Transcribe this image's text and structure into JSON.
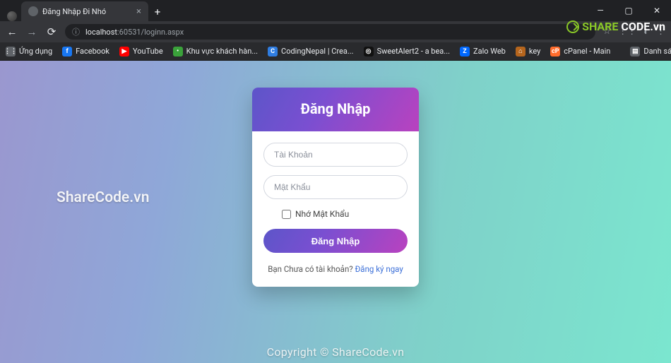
{
  "browser": {
    "tab_title": "Đăng Nhập Đi Nhó",
    "url_host": "localhost",
    "url_rest": ":60531/loginn.aspx",
    "window_controls": {
      "min": "—",
      "max": "▢",
      "close": "✕"
    },
    "bookmarks_label": "Ứng dụng",
    "bookmarks": [
      {
        "label": "Facebook",
        "bg": "#1877f2",
        "ch": "f"
      },
      {
        "label": "YouTube",
        "bg": "#ff0000",
        "ch": "▶"
      },
      {
        "label": "Khu vực khách hàn...",
        "bg": "#3aa23a",
        "ch": "•"
      },
      {
        "label": "CodingNepal | Crea...",
        "bg": "#2f7de1",
        "ch": "C"
      },
      {
        "label": "SweetAlert2 - a bea...",
        "bg": "#111",
        "ch": "◎"
      },
      {
        "label": "Zalo Web",
        "bg": "#0068ff",
        "ch": "Z"
      },
      {
        "label": "key",
        "bg": "#b5651d",
        "ch": "⌂"
      },
      {
        "label": "cPanel - Main",
        "bg": "#ff6c2c",
        "ch": "cP"
      }
    ],
    "reading_list": "Danh sách đọc"
  },
  "login": {
    "title": "Đăng Nhập",
    "username_placeholder": "Tài Khoản",
    "password_placeholder": "Mật Khẩu",
    "remember_label": "Nhớ Mật Khẩu",
    "submit_label": "Đăng Nhập",
    "no_account_text": "Bạn Chưa có tài khoản? ",
    "signup_link": "Đăng ký ngay"
  },
  "watermarks": {
    "side": "ShareCode.vn",
    "bottom": "Copyright © ShareCode.vn",
    "brand_a": "SHARE",
    "brand_b": "CODE.vn"
  }
}
